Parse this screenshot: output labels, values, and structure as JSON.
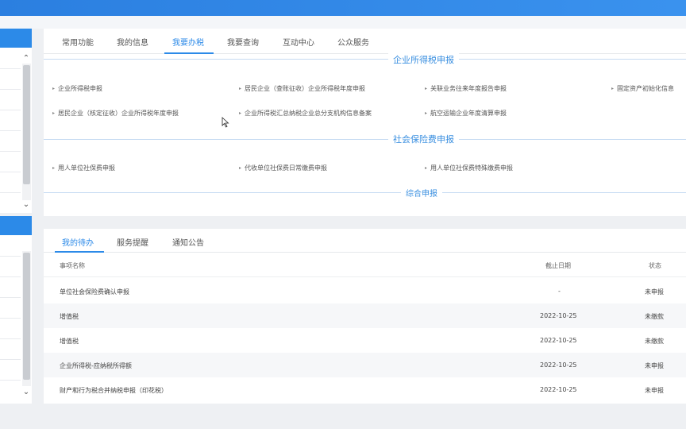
{
  "top_tabs": [
    {
      "label": "常用功能",
      "active": false
    },
    {
      "label": "我的信息",
      "active": false
    },
    {
      "label": "我要办税",
      "active": true
    },
    {
      "label": "我要查询",
      "active": false
    },
    {
      "label": "互动中心",
      "active": false
    },
    {
      "label": "公众服务",
      "active": false
    }
  ],
  "sections": {
    "corp_income": {
      "title": "企业所得税申报",
      "links": [
        "企业所得税申报",
        "居民企业（查账征收）企业所得税年度申报",
        "关联业务往来年度报告申报",
        "固定资产初始化信息",
        "居民企业（核定征收）企业所得税年度申报",
        "企业所得税汇总纳税企业总分支机构信息备案",
        "航空运输企业年度清算申报"
      ]
    },
    "social_insurance": {
      "title": "社会保险费申报",
      "links": [
        "用人单位社保费申报",
        "代收单位社保费日常缴费申报",
        "用人单位社保费特殊缴费申报"
      ]
    },
    "comprehensive": {
      "title": "综合申报"
    }
  },
  "bottom_tabs": [
    {
      "label": "我的待办",
      "active": true
    },
    {
      "label": "服务提醒",
      "active": false
    },
    {
      "label": "通知公告",
      "active": false
    }
  ],
  "table": {
    "headers": {
      "name": "事项名称",
      "deadline": "截止日期",
      "status": "状态"
    },
    "rows": [
      {
        "name": "单位社会保险费确认申报",
        "deadline": "-",
        "status": "未申报"
      },
      {
        "name": "增值税",
        "deadline": "2022-10-25",
        "status": "未缴款"
      },
      {
        "name": "增值税",
        "deadline": "2022-10-25",
        "status": "未缴款"
      },
      {
        "name": "企业所得税-应纳税所得额",
        "deadline": "2022-10-25",
        "status": "未申报"
      },
      {
        "name": "财产和行为税合并纳税申报（印花税）",
        "deadline": "2022-10-25",
        "status": "未申报"
      }
    ]
  },
  "icons": {
    "scroll_up": "chevron-up-icon",
    "scroll_down": "chevron-down-icon",
    "link_bullet": "triangle-right-icon"
  },
  "colors": {
    "accent": "#2c8ae8",
    "section_title": "#3a8fe0",
    "topbar": "#2b7fe0"
  }
}
